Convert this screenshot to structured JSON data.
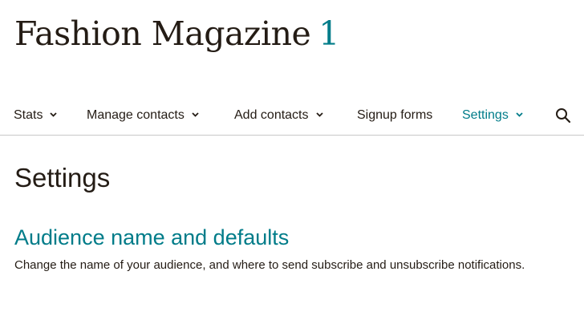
{
  "audience": {
    "name": "Fashion Magazine",
    "count": "1"
  },
  "nav": {
    "items": [
      {
        "label": "Stats",
        "icon": "chevron-down-icon",
        "active": false
      },
      {
        "label": "Manage contacts",
        "icon": "chevron-down-icon",
        "active": false
      },
      {
        "label": "Add contacts",
        "icon": "chevron-down-icon",
        "active": false
      },
      {
        "label": "Signup forms",
        "active": false
      },
      {
        "label": "Settings",
        "icon": "chevron-down-icon",
        "active": true
      }
    ],
    "search_icon": "search-icon"
  },
  "page": {
    "title": "Settings"
  },
  "section": {
    "heading": "Audience name and defaults",
    "description": "Change the name of your audience, and where to send subscribe and unsubscribe notifications."
  },
  "colors": {
    "accent": "#007c89",
    "text": "#241c15",
    "divider": "#c8c8c8",
    "background": "#ffffff"
  }
}
